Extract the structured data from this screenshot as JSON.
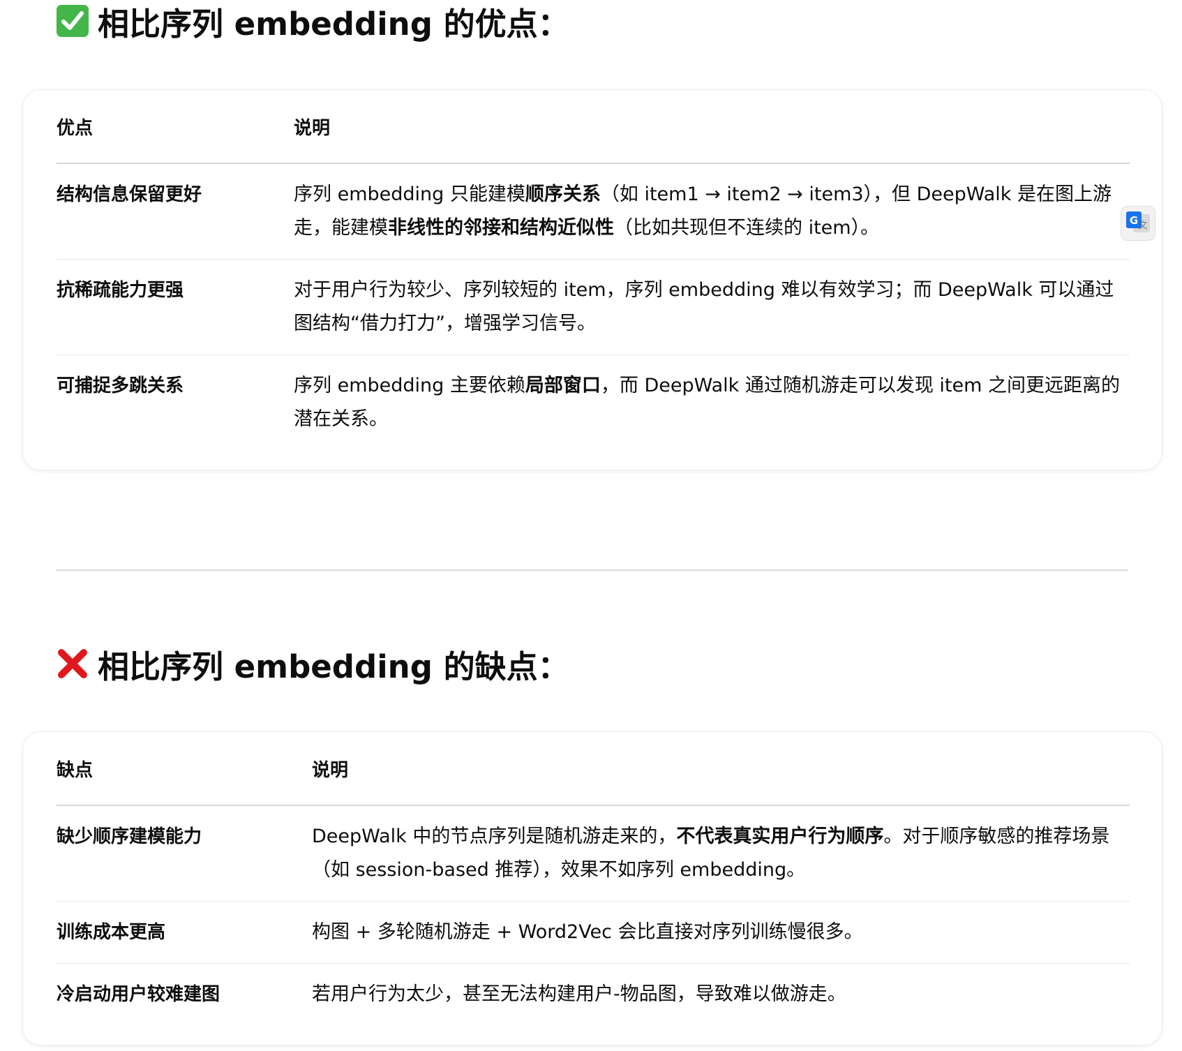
{
  "pros": {
    "title": "相比序列 embedding 的优点：",
    "icon": "check-mark-button-icon",
    "header_col1": "优点",
    "header_col2": "说明",
    "rows": [
      {
        "name": "结构信息保留更好",
        "desc": [
          {
            "t": "序列 embedding 只能建模"
          },
          {
            "t": "顺序关系",
            "b": true
          },
          {
            "t": "（如 item1 → item2 → item3），但 DeepWalk 是在图上游走，能建模"
          },
          {
            "t": "非线性的邻接和结构近似性",
            "b": true
          },
          {
            "t": "（比如共现但不连续的 item）。"
          }
        ]
      },
      {
        "name": "抗稀疏能力更强",
        "desc": [
          {
            "t": "对于用户行为较少、序列较短的 item，序列 embedding 难以有效学习；而 DeepWalk 可以通过图结构“借力打力”，增强学习信号。"
          }
        ]
      },
      {
        "name": "可捕捉多跳关系",
        "desc": [
          {
            "t": "序列 embedding 主要依赖"
          },
          {
            "t": "局部窗口",
            "b": true
          },
          {
            "t": "，而 DeepWalk 通过随机游走可以发现 item 之间更远距离的潜在关系。"
          }
        ]
      }
    ]
  },
  "cons": {
    "title": "相比序列 embedding 的缺点：",
    "icon": "cross-mark-icon",
    "header_col1": "缺点",
    "header_col2": "说明",
    "rows": [
      {
        "name": "缺少顺序建模能力",
        "desc": [
          {
            "t": "DeepWalk 中的节点序列是随机游走来的，"
          },
          {
            "t": "不代表真实用户行为顺序",
            "b": true
          },
          {
            "t": "。对于顺序敏感的推荐场景（如 session-based 推荐），效果不如序列 embedding。"
          }
        ]
      },
      {
        "name": "训练成本更高",
        "desc": [
          {
            "t": "构图 + 多轮随机游走 + Word2Vec 会比直接对序列训练慢很多。"
          }
        ]
      },
      {
        "name": "冷启动用户较难建图",
        "desc": [
          {
            "t": "若用户行为太少，甚至无法构建用户-物品图，导致难以做游走。"
          }
        ]
      }
    ]
  },
  "translate_button_icon": "google-translate-icon",
  "colors": {
    "check_green": "#43b649",
    "cross_red": "#e0181e",
    "translate_blue": "#1a73e8"
  }
}
